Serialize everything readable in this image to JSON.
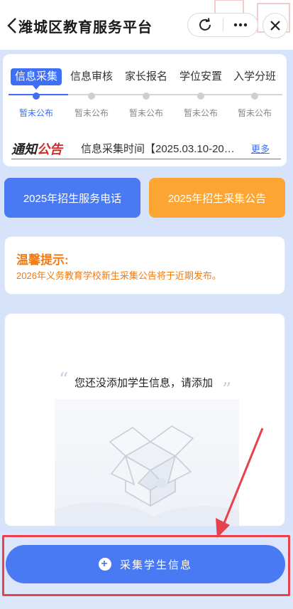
{
  "header": {
    "title": "潍城区教育服务平台",
    "refresh_icon": "refresh-icon",
    "more_icon": "more-icon",
    "close_icon": "close-icon"
  },
  "steps": [
    {
      "label": "信息采集",
      "status": "暂未公布",
      "active": true
    },
    {
      "label": "信息审核",
      "status": "暂未公布",
      "active": false
    },
    {
      "label": "家长报名",
      "status": "暂未公布",
      "active": false
    },
    {
      "label": "学位安置",
      "status": "暂未公布",
      "active": false
    },
    {
      "label": "入学分班",
      "status": "暂未公布",
      "active": false
    }
  ],
  "notice": {
    "logo_part1": "通知",
    "logo_part2": "公告",
    "text": "信息采集时间【2025.03.10-20…",
    "more": "更多"
  },
  "buttons": {
    "hotline": "2025年招生服务电话",
    "announcement": "2025年招生采集公告"
  },
  "tip": {
    "title": "温馨提示:",
    "text": "2026年义务教育学校新生采集公告将于近期发布。"
  },
  "empty": {
    "message": "您还没添加学生信息，请添加"
  },
  "bottom": {
    "collect_label": "采集学生信息"
  },
  "colors": {
    "accent": "#4a7af3",
    "orange": "#fca533",
    "warning_text": "#f27a12",
    "highlight": "#e8414b"
  }
}
